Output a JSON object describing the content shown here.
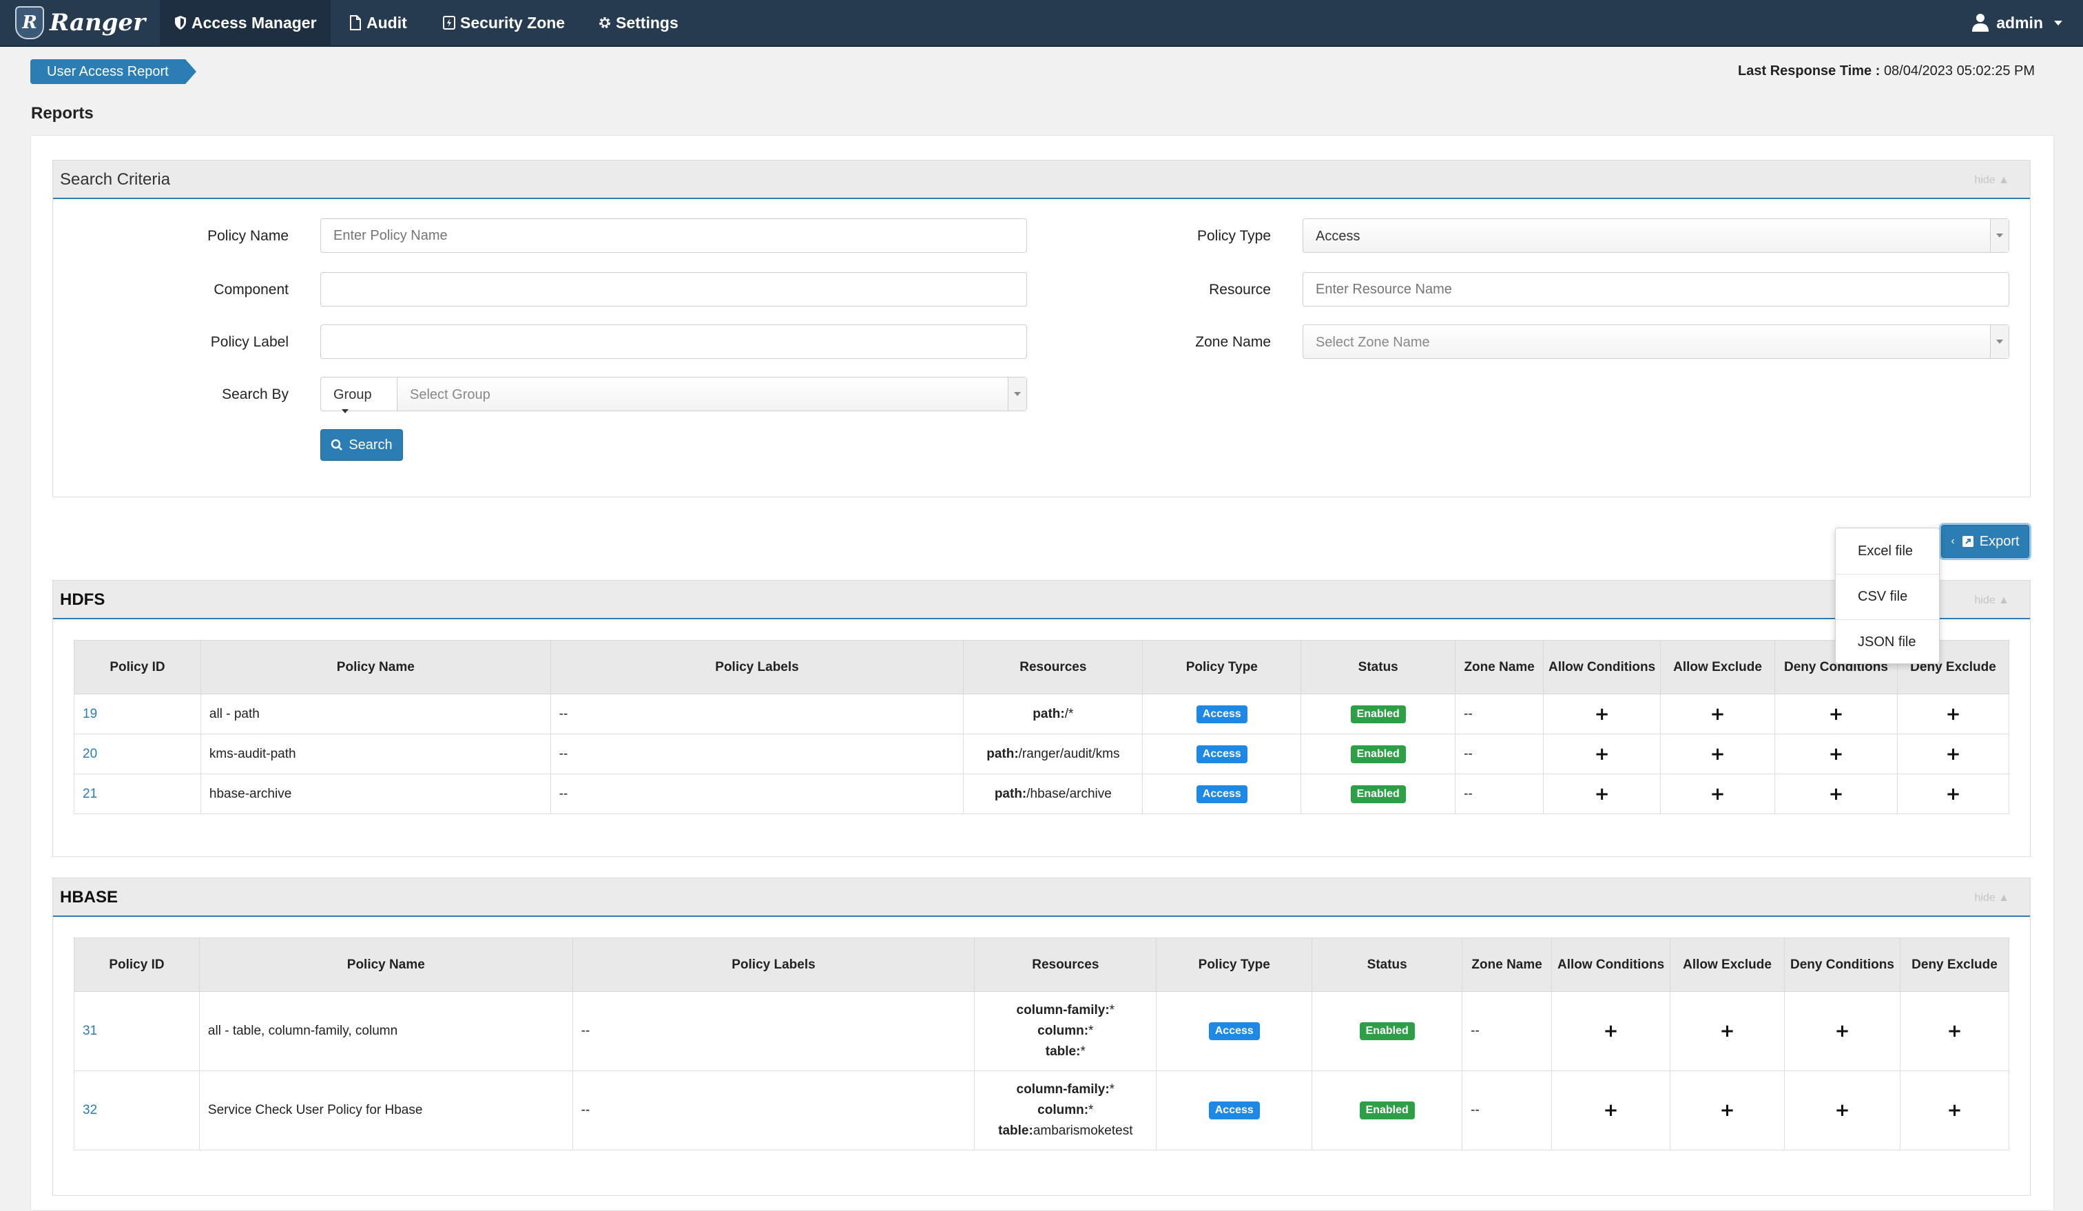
{
  "navbar": {
    "brand": "Ranger",
    "items": [
      {
        "label": "Access Manager"
      },
      {
        "label": "Audit"
      },
      {
        "label": "Security Zone"
      },
      {
        "label": "Settings"
      }
    ],
    "user": "admin"
  },
  "breadcrumb": "User Access Report",
  "last_response": {
    "label": "Last Response Time :",
    "value": "08/04/2023 05:02:25 PM"
  },
  "page_title": "Reports",
  "search": {
    "title": "Search Criteria",
    "hide": "hide",
    "policy_name_label": "Policy Name",
    "policy_name_placeholder": "Enter Policy Name",
    "component_label": "Component",
    "policy_label_label": "Policy Label",
    "search_by_label": "Search By",
    "search_by_value": "Group",
    "group_placeholder": "Select Group",
    "policy_type_label": "Policy Type",
    "policy_type_value": "Access",
    "resource_label": "Resource",
    "resource_placeholder": "Enter Resource Name",
    "zone_label": "Zone Name",
    "zone_placeholder": "Select Zone Name",
    "search_button": "Search"
  },
  "export": {
    "button": "Export",
    "options": [
      "Excel file",
      "CSV file",
      "JSON file"
    ]
  },
  "columns": [
    "Policy ID",
    "Policy Name",
    "Policy Labels",
    "Resources",
    "Policy Type",
    "Status",
    "Zone Name",
    "Allow Conditions",
    "Allow Exclude",
    "Deny Conditions",
    "Deny Exclude"
  ],
  "hdfs": {
    "title": "HDFS",
    "hide": "hide",
    "rows": [
      {
        "id": "19",
        "name": "all - path",
        "labels": "--",
        "res": [
          [
            "path:",
            "/*"
          ]
        ],
        "type": "Access",
        "status": "Enabled",
        "zone": "--"
      },
      {
        "id": "20",
        "name": "kms-audit-path",
        "labels": "--",
        "res": [
          [
            "path:",
            "/ranger/audit/kms"
          ]
        ],
        "type": "Access",
        "status": "Enabled",
        "zone": "--"
      },
      {
        "id": "21",
        "name": "hbase-archive",
        "labels": "--",
        "res": [
          [
            "path:",
            "/hbase/archive"
          ]
        ],
        "type": "Access",
        "status": "Enabled",
        "zone": "--"
      }
    ]
  },
  "hbase": {
    "title": "HBASE",
    "hide": "hide",
    "rows": [
      {
        "id": "31",
        "name": "all - table, column-family, column",
        "labels": "--",
        "res": [
          [
            "column-family:",
            "*"
          ],
          [
            "column:",
            "*"
          ],
          [
            "table:",
            "*"
          ]
        ],
        "type": "Access",
        "status": "Enabled",
        "zone": "--"
      },
      {
        "id": "32",
        "name": "Service Check User Policy for Hbase",
        "labels": "--",
        "res": [
          [
            "column-family:",
            "*"
          ],
          [
            "column:",
            "*"
          ],
          [
            "table:",
            "ambarismoketest"
          ]
        ],
        "type": "Access",
        "status": "Enabled",
        "zone": "--"
      }
    ]
  },
  "plus_symbol": "+"
}
